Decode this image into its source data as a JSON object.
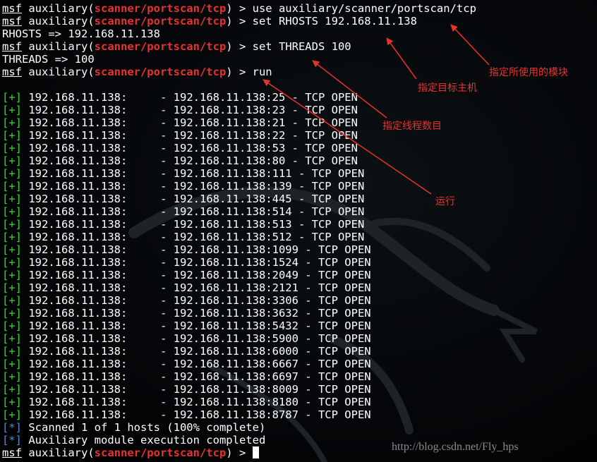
{
  "terminal": {
    "prompt_prefix": "msf",
    "prompt_module_open": " auxiliary(",
    "prompt_module": "scanner/portscan/tcp",
    "prompt_module_close": ") > ",
    "commands": [
      {
        "type": "prompt",
        "command": "use auxiliary/scanner/portscan/tcp"
      },
      {
        "type": "prompt",
        "command": "set RHOSTS 192.168.11.138"
      },
      {
        "type": "output",
        "text": "RHOSTS => 192.168.11.138"
      },
      {
        "type": "prompt",
        "command": "set THREADS 100"
      },
      {
        "type": "output",
        "text": "THREADS => 100"
      },
      {
        "type": "prompt",
        "command": "run"
      },
      {
        "type": "blank",
        "text": ""
      }
    ],
    "scan_marker": "[+]",
    "scan_host": "192.168.11.138:",
    "scan_results": [
      {
        "endpoint": "192.168.11.138:25",
        "status": "TCP OPEN"
      },
      {
        "endpoint": "192.168.11.138:23",
        "status": "TCP OPEN"
      },
      {
        "endpoint": "192.168.11.138:21",
        "status": "TCP OPEN"
      },
      {
        "endpoint": "192.168.11.138:22",
        "status": "TCP OPEN"
      },
      {
        "endpoint": "192.168.11.138:53",
        "status": "TCP OPEN"
      },
      {
        "endpoint": "192.168.11.138:80",
        "status": "TCP OPEN"
      },
      {
        "endpoint": "192.168.11.138:111",
        "status": "TCP OPEN"
      },
      {
        "endpoint": "192.168.11.138:139",
        "status": "TCP OPEN"
      },
      {
        "endpoint": "192.168.11.138:445",
        "status": "TCP OPEN"
      },
      {
        "endpoint": "192.168.11.138:514",
        "status": "TCP OPEN"
      },
      {
        "endpoint": "192.168.11.138:513",
        "status": "TCP OPEN"
      },
      {
        "endpoint": "192.168.11.138:512",
        "status": "TCP OPEN"
      },
      {
        "endpoint": "192.168.11.138:1099",
        "status": "TCP OPEN"
      },
      {
        "endpoint": "192.168.11.138:1524",
        "status": "TCP OPEN"
      },
      {
        "endpoint": "192.168.11.138:2049",
        "status": "TCP OPEN"
      },
      {
        "endpoint": "192.168.11.138:2121",
        "status": "TCP OPEN"
      },
      {
        "endpoint": "192.168.11.138:3306",
        "status": "TCP OPEN"
      },
      {
        "endpoint": "192.168.11.138:3632",
        "status": "TCP OPEN"
      },
      {
        "endpoint": "192.168.11.138:5432",
        "status": "TCP OPEN"
      },
      {
        "endpoint": "192.168.11.138:5900",
        "status": "TCP OPEN"
      },
      {
        "endpoint": "192.168.11.138:6000",
        "status": "TCP OPEN"
      },
      {
        "endpoint": "192.168.11.138:6667",
        "status": "TCP OPEN"
      },
      {
        "endpoint": "192.168.11.138:6697",
        "status": "TCP OPEN"
      },
      {
        "endpoint": "192.168.11.138:8009",
        "status": "TCP OPEN"
      },
      {
        "endpoint": "192.168.11.138:8180",
        "status": "TCP OPEN"
      },
      {
        "endpoint": "192.168.11.138:8787",
        "status": "TCP OPEN"
      }
    ],
    "info_marker": "[*]",
    "info_lines": [
      "Scanned 1 of 1 hosts (100% complete)",
      "Auxiliary module execution completed"
    ]
  },
  "annotations": {
    "module": "指定所使用的模块",
    "target": "指定目标主机",
    "threads": "指定线程数目",
    "run": "运行"
  },
  "watermark": "http://blog.csdn.net/Fly_hps",
  "colors": {
    "background": "#000000",
    "text": "#ffffff",
    "module_red": "#e8322e",
    "success_green": "#38d730",
    "info_blue": "#4f8ad6",
    "annotation_red": "#e8322e"
  },
  "icons": {
    "background_art": "kali-dragon-logo"
  }
}
